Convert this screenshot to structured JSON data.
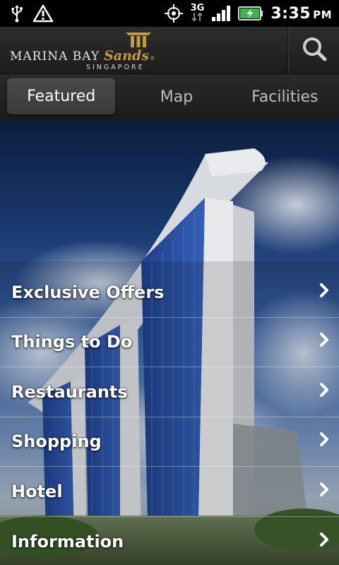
{
  "status_bar": {
    "network": "3G",
    "time": "3:35",
    "ampm": "PM",
    "icons": [
      "usb-icon",
      "warning-icon",
      "gps-icon",
      "network-3g-icon",
      "signal-icon",
      "battery-charging-icon"
    ]
  },
  "header": {
    "logo": {
      "marina_bay": "MARINA BAY",
      "sands": "Sands",
      "reg": "®",
      "singapore": "SINGAPORE"
    },
    "search_icon": "search-icon"
  },
  "tabs": [
    {
      "label": "Featured",
      "active": true
    },
    {
      "label": "Map",
      "active": false
    },
    {
      "label": "Facilities",
      "active": false
    }
  ],
  "menu": [
    {
      "label": "Exclusive Offers"
    },
    {
      "label": "Things to Do"
    },
    {
      "label": "Restaurants"
    },
    {
      "label": "Shopping"
    },
    {
      "label": "Hotel"
    },
    {
      "label": "Information"
    }
  ],
  "colors": {
    "brand_gold": "#c49a3e",
    "tab_active": "#404040",
    "status_bar": "#000000"
  }
}
